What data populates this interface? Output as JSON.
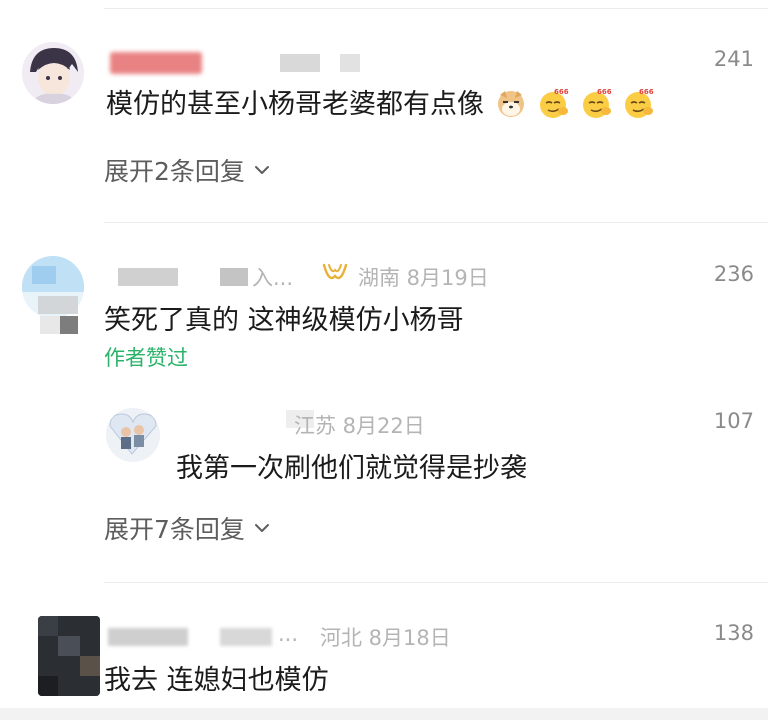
{
  "comments": [
    {
      "likes": "241",
      "text": "模仿的甚至小杨哥老婆都有点像",
      "expand_label": "展开2条回复",
      "emojis": [
        "shiba-dog-emoji",
        "smirk-666-emoji",
        "smirk-666-emoji",
        "smirk-666-emoji"
      ]
    },
    {
      "username_tail": "入...",
      "location_date": "湖南 8月19日",
      "likes": "236",
      "text": "笑死了真的 这神级模仿小杨哥",
      "author_liked": "作者赞过",
      "reply": {
        "location_date": "江苏 8月22日",
        "likes": "107",
        "text": "我第一次刷他们就觉得是抄袭"
      },
      "expand_label": "展开7条回复"
    },
    {
      "username_tail": "...",
      "location_date": "河北 8月18日",
      "likes": "138",
      "text": "我去 连媳妇也模仿"
    }
  ],
  "colors": {
    "heart_stroke": "#8a8a8a",
    "author_liked": "#2cb36a",
    "badge_gold": "#e8b23a"
  }
}
